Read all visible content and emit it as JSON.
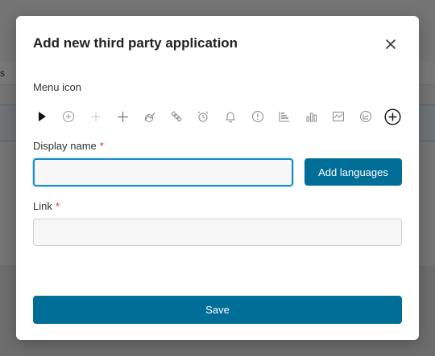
{
  "background": {
    "partial_tab_text": "s"
  },
  "modal": {
    "title": "Add new third party application",
    "close_icon": "close-icon",
    "menu_icon_label": "Menu icon",
    "icons": [
      "play-icon",
      "add-circle-icon",
      "plus-light-icon",
      "plus-icon",
      "chart-line-icon",
      "satellite-icon",
      "alarm-icon",
      "bell-icon",
      "alert-circle-icon",
      "bar-chart-horizontal-icon",
      "bar-chart-icon",
      "area-chart-icon",
      "chart-circle-icon",
      "add-circle-bold-icon"
    ],
    "display_name_label": "Display name",
    "display_name_value": "",
    "add_languages_label": "Add languages",
    "link_label": "Link",
    "link_value": "",
    "required_marker": "*",
    "save_label": "Save"
  },
  "colors": {
    "primary": "#006e96",
    "required": "#d32f2f",
    "focus": "#1a8dc4"
  }
}
